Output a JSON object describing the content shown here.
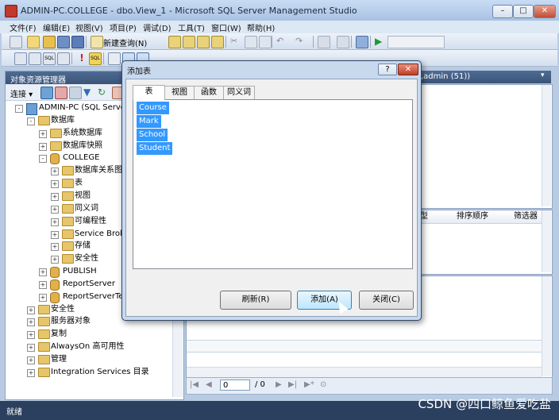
{
  "window": {
    "title": "ADMIN-PC.COLLEGE - dbo.View_1 - Microsoft SQL Server Management Studio"
  },
  "menu": [
    "文件(F)",
    "编辑(E)",
    "视图(V)",
    "项目(P)",
    "调试(D)",
    "工具(T)",
    "窗口(W)",
    "帮助(H)"
  ],
  "toolbar": {
    "new_query": "新建查询(N)"
  },
  "object_explorer": {
    "title": "对象资源管理器",
    "connect": "连接",
    "tree": [
      {
        "label": "ADMIN-PC (SQL Server",
        "level": 0,
        "icon": "server",
        "exp": "-"
      },
      {
        "label": "数据库",
        "level": 1,
        "icon": "folder",
        "exp": "-"
      },
      {
        "label": "系统数据库",
        "level": 2,
        "icon": "folder",
        "exp": "+"
      },
      {
        "label": "数据库快照",
        "level": 2,
        "icon": "folder",
        "exp": "+"
      },
      {
        "label": "COLLEGE",
        "level": 2,
        "icon": "db",
        "exp": "-"
      },
      {
        "label": "数据库关系图",
        "level": 3,
        "icon": "folder",
        "exp": "+"
      },
      {
        "label": "表",
        "level": 3,
        "icon": "folder",
        "exp": "+"
      },
      {
        "label": "视图",
        "level": 3,
        "icon": "folder",
        "exp": "+"
      },
      {
        "label": "同义词",
        "level": 3,
        "icon": "folder",
        "exp": "+"
      },
      {
        "label": "可编程性",
        "level": 3,
        "icon": "folder",
        "exp": "+"
      },
      {
        "label": "Service Broke",
        "level": 3,
        "icon": "folder",
        "exp": "+"
      },
      {
        "label": "存储",
        "level": 3,
        "icon": "folder",
        "exp": "+"
      },
      {
        "label": "安全性",
        "level": 3,
        "icon": "folder",
        "exp": "+"
      },
      {
        "label": "PUBLISH",
        "level": 2,
        "icon": "db",
        "exp": "+"
      },
      {
        "label": "ReportServer",
        "level": 2,
        "icon": "db",
        "exp": "+"
      },
      {
        "label": "ReportServerTen",
        "level": 2,
        "icon": "db",
        "exp": "+"
      },
      {
        "label": "安全性",
        "level": 1,
        "icon": "folder",
        "exp": "+"
      },
      {
        "label": "服务器对象",
        "level": 1,
        "icon": "folder",
        "exp": "+"
      },
      {
        "label": "复制",
        "level": 1,
        "icon": "folder",
        "exp": "+"
      },
      {
        "label": "AlwaysOn 高可用性",
        "level": 1,
        "icon": "folder",
        "exp": "+"
      },
      {
        "label": "管理",
        "level": 1,
        "icon": "folder",
        "exp": "+"
      },
      {
        "label": "Integration Services 目录",
        "level": 1,
        "icon": "folder",
        "exp": "+"
      }
    ]
  },
  "document": {
    "tab_fragment": ",admin (51))",
    "grid_columns": [
      "型",
      "排序顺序",
      "筛选器"
    ],
    "nav_page": "0",
    "nav_total": "/ 0"
  },
  "dialog": {
    "title": "添加表",
    "help": "?",
    "tabs": [
      "表",
      "视图",
      "函数",
      "同义词"
    ],
    "active_tab": 0,
    "tables": [
      "Course",
      "Mark",
      "School",
      "Student"
    ],
    "buttons": {
      "refresh": "刷新(R)",
      "add": "添加(A)",
      "close": "关闭(C)"
    }
  },
  "status": {
    "text": "就绪"
  },
  "watermark": "CSDN @四口鲸鱼爱吃盐"
}
